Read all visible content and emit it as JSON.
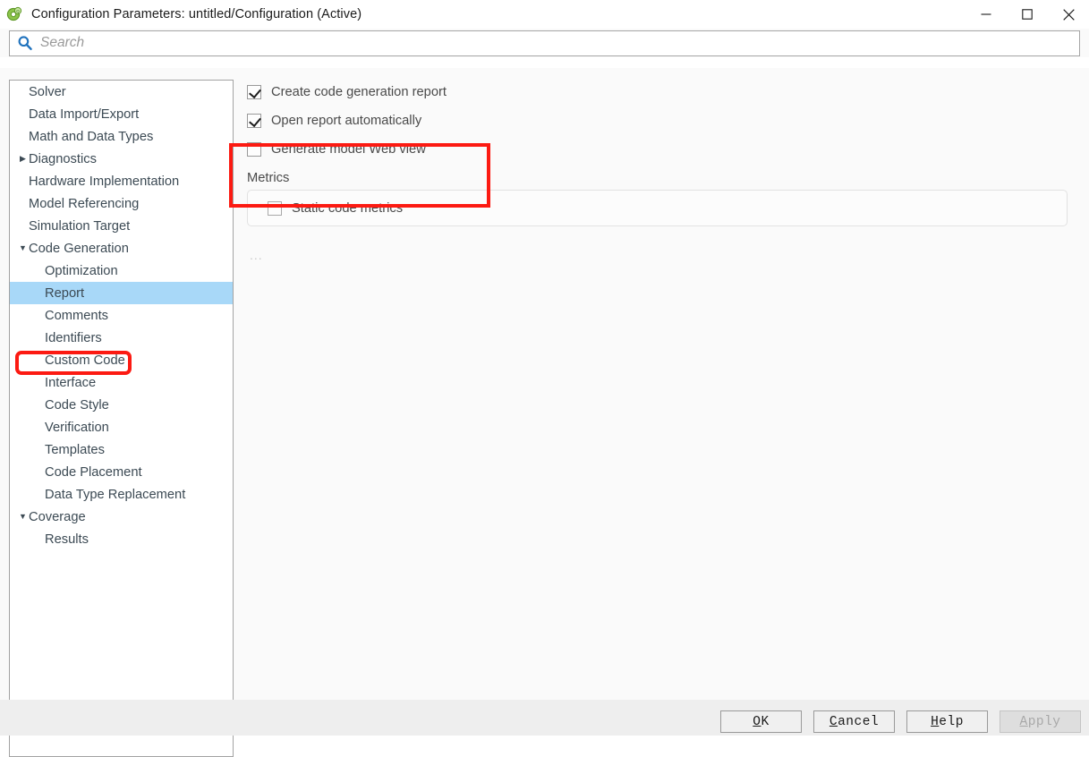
{
  "window": {
    "title": "Configuration Parameters: untitled/Configuration (Active)",
    "app_icon": "simulink-config-icon",
    "minimize_label": "—",
    "maximize_label": "□",
    "close_label": "✕"
  },
  "search": {
    "placeholder": "Search",
    "value": "",
    "icon": "search-icon"
  },
  "tree": {
    "items": [
      {
        "label": "Solver",
        "level": 0,
        "arrow": "",
        "selected": false
      },
      {
        "label": "Data Import/Export",
        "level": 0,
        "arrow": "",
        "selected": false
      },
      {
        "label": "Math and Data Types",
        "level": 0,
        "arrow": "",
        "selected": false
      },
      {
        "label": "Diagnostics",
        "level": 0,
        "arrow": "▶",
        "selected": false
      },
      {
        "label": "Hardware Implementation",
        "level": 0,
        "arrow": "",
        "selected": false
      },
      {
        "label": "Model Referencing",
        "level": 0,
        "arrow": "",
        "selected": false
      },
      {
        "label": "Simulation Target",
        "level": 0,
        "arrow": "",
        "selected": false
      },
      {
        "label": "Code Generation",
        "level": 0,
        "arrow": "▼",
        "selected": false
      },
      {
        "label": "Optimization",
        "level": 1,
        "arrow": "",
        "selected": false
      },
      {
        "label": "Report",
        "level": 1,
        "arrow": "",
        "selected": true
      },
      {
        "label": "Comments",
        "level": 1,
        "arrow": "",
        "selected": false
      },
      {
        "label": "Identifiers",
        "level": 1,
        "arrow": "",
        "selected": false
      },
      {
        "label": "Custom Code",
        "level": 1,
        "arrow": "",
        "selected": false
      },
      {
        "label": "Interface",
        "level": 1,
        "arrow": "",
        "selected": false
      },
      {
        "label": "Code Style",
        "level": 1,
        "arrow": "",
        "selected": false
      },
      {
        "label": "Verification",
        "level": 1,
        "arrow": "",
        "selected": false
      },
      {
        "label": "Templates",
        "level": 1,
        "arrow": "",
        "selected": false
      },
      {
        "label": "Code Placement",
        "level": 1,
        "arrow": "",
        "selected": false
      },
      {
        "label": "Data Type Replacement",
        "level": 1,
        "arrow": "",
        "selected": false
      },
      {
        "label": "Coverage",
        "level": 0,
        "arrow": "▼",
        "selected": false
      },
      {
        "label": "Results",
        "level": 1,
        "arrow": "",
        "selected": false
      }
    ]
  },
  "pane": {
    "checkboxes": [
      {
        "label": "Create code generation report",
        "checked": true
      },
      {
        "label": "Open report automatically",
        "checked": true
      },
      {
        "label": "Generate model Web view",
        "checked": false
      }
    ],
    "metrics": {
      "title": "Metrics",
      "checkbox": {
        "label": "Static code metrics",
        "checked": false
      }
    },
    "ellipsis": "..."
  },
  "footer": {
    "buttons": [
      {
        "mnemonic": "O",
        "rest": "K",
        "disabled": false,
        "name": "ok-button"
      },
      {
        "mnemonic": "C",
        "rest": "ancel",
        "disabled": false,
        "name": "cancel-button"
      },
      {
        "mnemonic": "H",
        "rest": "elp",
        "disabled": false,
        "name": "help-button"
      },
      {
        "mnemonic": "A",
        "rest": "pply",
        "disabled": true,
        "name": "apply-button"
      }
    ]
  },
  "colors": {
    "selection_blue": "#a8d8f8",
    "annotation_red": "#fc1a12",
    "tree_text": "#3c4a54",
    "search_icon_blue": "#1f72bd",
    "footer_bg": "#eeeeee"
  }
}
